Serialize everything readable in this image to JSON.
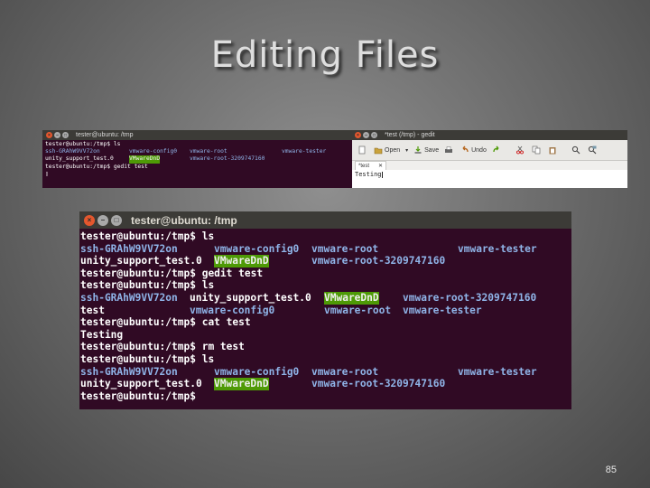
{
  "slide": {
    "title": "Editing Files",
    "page_number": "85"
  },
  "small_terminal": {
    "title": "tester@ubuntu: /tmp",
    "rows": [
      [
        {
          "t": "tester@ubuntu:/tmp$ ls",
          "s": "w"
        }
      ],
      [
        {
          "t": "ssh-GRAhW9VV72on",
          "s": "b"
        },
        {
          "t": "vmware-config0",
          "s": "b"
        },
        {
          "t": "vmware-root",
          "s": "b"
        },
        {
          "t": "vmware-tester",
          "s": "b"
        }
      ],
      [
        {
          "t": "unity_support_test.0",
          "s": "w"
        },
        {
          "t": "VMwareDnD",
          "s": "g"
        },
        {
          "t": "vmware-root-3209747160",
          "s": "b"
        }
      ],
      [
        {
          "t": "tester@ubuntu:/tmp$ gedit test",
          "s": "w"
        }
      ],
      [
        {
          "t": "▯",
          "s": "w"
        }
      ]
    ]
  },
  "gedit": {
    "title": "*test (/tmp) - gedit",
    "toolbar": {
      "open": "Open",
      "save": "Save",
      "undo": "Undo"
    },
    "tab_label": "*test",
    "tab_close": "✕",
    "content": "Testing"
  },
  "terminal": {
    "title": "tester@ubuntu: /tmp",
    "rows": [
      [
        {
          "t": "tester@ubuntu:/tmp$ ls",
          "s": "w"
        }
      ],
      [
        {
          "t": "ssh-GRAhW9VV72on",
          "s": "b"
        },
        {
          "t": "vmware-config0",
          "s": "b"
        },
        {
          "t": "vmware-root",
          "s": "b"
        },
        {
          "t": "vmware-tester",
          "s": "b"
        }
      ],
      [
        {
          "t": "unity_support_test.0",
          "s": "w"
        },
        {
          "t": "VMwareDnD",
          "s": "g"
        },
        {
          "t": "vmware-root-3209747160",
          "s": "b"
        }
      ],
      [
        {
          "t": "tester@ubuntu:/tmp$ gedit test",
          "s": "w"
        }
      ],
      [
        {
          "t": "tester@ubuntu:/tmp$ ls",
          "s": "w"
        }
      ],
      [
        {
          "t": "ssh-GRAhW9VV72on",
          "s": "b"
        },
        {
          "t": "unity_support_test.0",
          "s": "w"
        },
        {
          "t": "VMwareDnD",
          "s": "g"
        },
        {
          "t": "vmware-root-3209747160",
          "s": "b"
        }
      ],
      [
        {
          "t": "test",
          "s": "w"
        },
        {
          "t": "vmware-config0",
          "s": "b"
        },
        {
          "t": "vmware-root",
          "s": "b"
        },
        {
          "t": "vmware-tester",
          "s": "b"
        }
      ],
      [
        {
          "t": "tester@ubuntu:/tmp$ cat test",
          "s": "w"
        }
      ],
      [
        {
          "t": "Testing",
          "s": "w"
        }
      ],
      [
        {
          "t": "tester@ubuntu:/tmp$ rm test",
          "s": "w"
        }
      ],
      [
        {
          "t": "tester@ubuntu:/tmp$ ls",
          "s": "w"
        }
      ],
      [
        {
          "t": "ssh-GRAhW9VV72on",
          "s": "b"
        },
        {
          "t": "vmware-config0",
          "s": "b"
        },
        {
          "t": "vmware-root",
          "s": "b"
        },
        {
          "t": "vmware-tester",
          "s": "b"
        }
      ],
      [
        {
          "t": "unity_support_test.0",
          "s": "w"
        },
        {
          "t": "VMwareDnD",
          "s": "g"
        },
        {
          "t": "vmware-root-3209747160",
          "s": "b"
        }
      ],
      [
        {
          "t": "tester@ubuntu:/tmp$",
          "s": "w"
        }
      ]
    ]
  },
  "colors": {
    "terminal_bg": "#300a24",
    "dir_blue": "#8fb4e8",
    "highlight_green": "#4e9a06",
    "close_orange": "#e4572e"
  },
  "icons": [
    "close-icon",
    "minimize-icon",
    "maximize-icon",
    "new-document-icon",
    "open-folder-icon",
    "save-icon",
    "print-icon",
    "undo-icon",
    "redo-icon",
    "cut-icon",
    "copy-icon",
    "paste-icon",
    "search-icon",
    "replace-icon"
  ]
}
